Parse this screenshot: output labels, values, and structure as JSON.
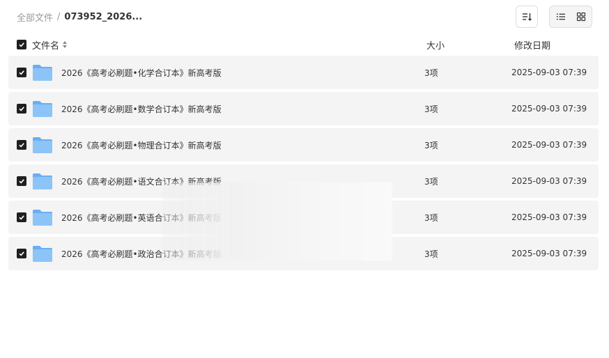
{
  "breadcrumb": {
    "root": "全部文件",
    "separator": "/",
    "current": "073952_2026..."
  },
  "toolbar": {
    "sort_icon": "sort-icon",
    "list_view_icon": "list-view-icon",
    "grid_view_icon": "grid-view-icon",
    "active_view": "grid"
  },
  "header": {
    "name": "文件名",
    "size": "大小",
    "modified": "修改日期"
  },
  "files": [
    {
      "name": "2026《高考必刷题•化学合订本》新高考版",
      "size": "3项",
      "modified": "2025-09-03 07:39"
    },
    {
      "name": "2026《高考必刷题•数学合订本》新高考版",
      "size": "3项",
      "modified": "2025-09-03 07:39"
    },
    {
      "name": "2026《高考必刷题•物理合订本》新高考版",
      "size": "3项",
      "modified": "2025-09-03 07:39"
    },
    {
      "name": "2026《高考必刷题•语文合订本》新高考版",
      "size": "3项",
      "modified": "2025-09-03 07:39"
    },
    {
      "name": "2026《高考必刷题•英语合订本》新高考版",
      "size": "3项",
      "modified": "2025-09-03 07:39"
    },
    {
      "name": "2026《高考必刷题•政治合订本》新高考版",
      "size": "3项",
      "modified": "2025-09-03 07:39"
    }
  ],
  "colors": {
    "row_bg": "#f4f4f4",
    "checkbox": "#1f1f1f",
    "folder": "#7ab8f5"
  }
}
